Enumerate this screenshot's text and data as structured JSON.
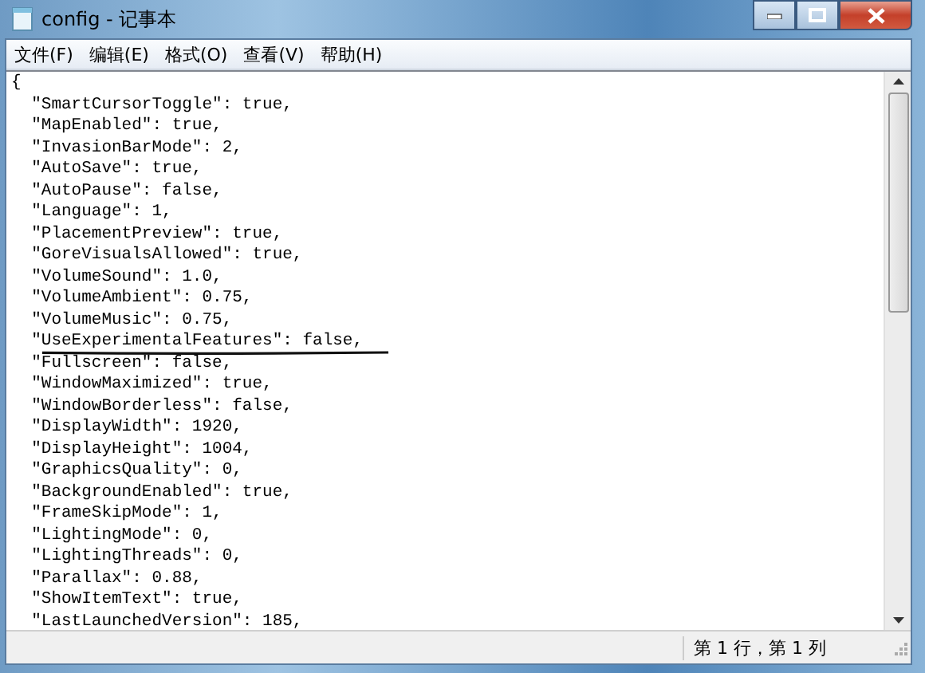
{
  "window": {
    "title": "config - 记事本"
  },
  "menu": [
    "文件(F)",
    "编辑(E)",
    "格式(O)",
    "查看(V)",
    "帮助(H)"
  ],
  "lines": [
    {
      "text": "{",
      "underlined": false
    },
    {
      "text": "  \"SmartCursorToggle\": true,",
      "underlined": false
    },
    {
      "text": "  \"MapEnabled\": true,",
      "underlined": false
    },
    {
      "text": "  \"InvasionBarMode\": 2,",
      "underlined": false
    },
    {
      "text": "  \"AutoSave\": true,",
      "underlined": false
    },
    {
      "text": "  \"AutoPause\": false,",
      "underlined": false
    },
    {
      "text": "  \"Language\": 1,",
      "underlined": false
    },
    {
      "text": "  \"PlacementPreview\": true,",
      "underlined": false
    },
    {
      "text": "  \"GoreVisualsAllowed\": true,",
      "underlined": false
    },
    {
      "text": "  \"VolumeSound\": 1.0,",
      "underlined": false
    },
    {
      "text": "  \"VolumeAmbient\": 0.75,",
      "underlined": false
    },
    {
      "text": "  \"VolumeMusic\": 0.75,",
      "underlined": false
    },
    {
      "text": "  \"UseExperimentalFeatures\": false,",
      "underlined": true
    },
    {
      "text": "  \"Fullscreen\": false,",
      "underlined": false
    },
    {
      "text": "  \"WindowMaximized\": true,",
      "underlined": false
    },
    {
      "text": "  \"WindowBorderless\": false,",
      "underlined": false
    },
    {
      "text": "  \"DisplayWidth\": 1920,",
      "underlined": false
    },
    {
      "text": "  \"DisplayHeight\": 1004,",
      "underlined": false
    },
    {
      "text": "  \"GraphicsQuality\": 0,",
      "underlined": false
    },
    {
      "text": "  \"BackgroundEnabled\": true,",
      "underlined": false
    },
    {
      "text": "  \"FrameSkipMode\": 1,",
      "underlined": false
    },
    {
      "text": "  \"LightingMode\": 0,",
      "underlined": false
    },
    {
      "text": "  \"LightingThreads\": 0,",
      "underlined": false
    },
    {
      "text": "  \"Parallax\": 0.88,",
      "underlined": false
    },
    {
      "text": "  \"ShowItemText\": true,",
      "underlined": false
    },
    {
      "text": "  \"LastLaunchedVersion\": 185,",
      "underlined": false
    }
  ],
  "status_bar": {
    "position": "第 1 行，第 1 列"
  }
}
